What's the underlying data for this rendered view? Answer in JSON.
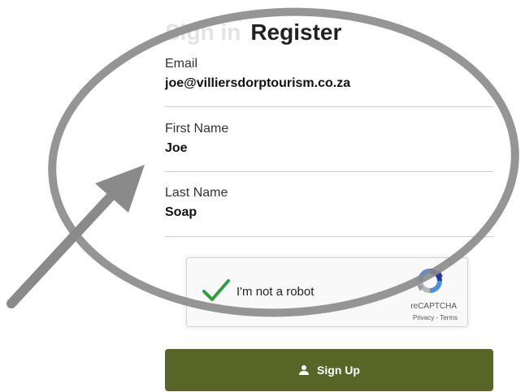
{
  "tabs": {
    "sign_in": "Sign in",
    "register": "Register"
  },
  "fields": {
    "email": {
      "label": "Email",
      "value": "joe@villiersdorptourism.co.za"
    },
    "first_name": {
      "label": "First Name",
      "value": "Joe"
    },
    "last_name": {
      "label": "Last Name",
      "value": "Soap"
    }
  },
  "recaptcha": {
    "label": "I'm not a robot",
    "checked": true,
    "brand": "reCAPTCHA",
    "links": "Privacy - Terms"
  },
  "signup": {
    "label": "Sign Up",
    "icon": "user-icon"
  },
  "colors": {
    "button": "#576626",
    "check": "#2e9e3e",
    "annotation": "#8a8a8a"
  }
}
